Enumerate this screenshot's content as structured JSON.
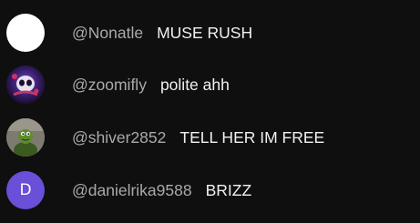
{
  "chat": {
    "messages": [
      {
        "author": "@Nonatle",
        "text": "MUSE RUSH",
        "avatar": {
          "kind": "blank",
          "color": "#ffffff"
        }
      },
      {
        "author": "@zoomifly",
        "text": "polite ahh",
        "avatar": {
          "kind": "image",
          "color": "#2a1a4a"
        }
      },
      {
        "author": "@shiver2852",
        "text": "TELL HER IM FREE",
        "avatar": {
          "kind": "image",
          "color": "#8a8578"
        }
      },
      {
        "author": "@danielrika9588",
        "text": "BRIZZ",
        "avatar": {
          "kind": "letter",
          "letter": "D",
          "color": "#6a4fd8"
        }
      }
    ]
  },
  "colors": {
    "background": "#0f0f0f",
    "author_text": "#aaaaaa",
    "message_text": "#f1f1f1"
  }
}
